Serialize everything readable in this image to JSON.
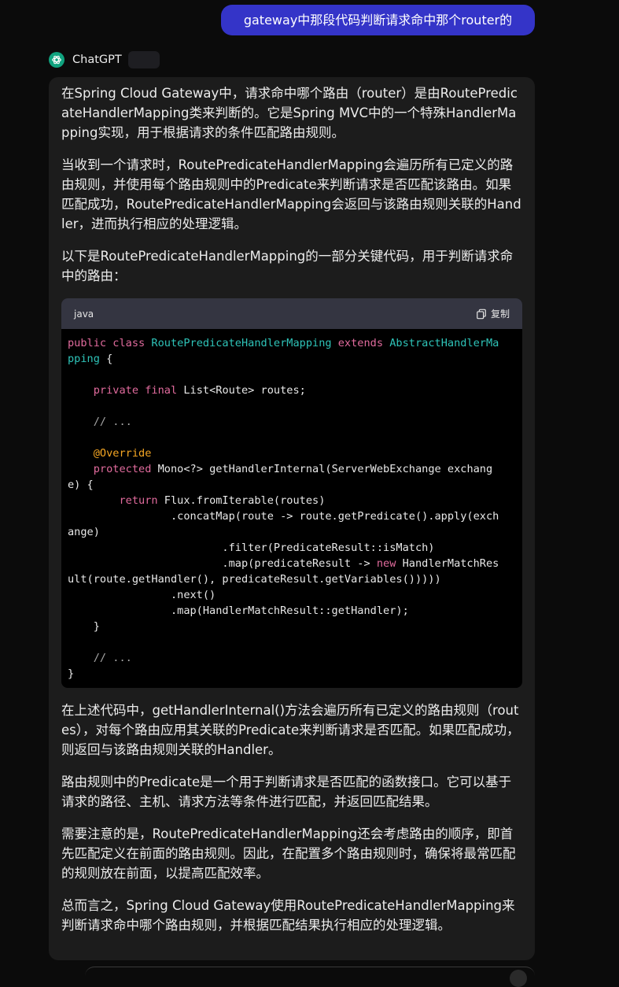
{
  "user_message": "gateway中那段代码判断请求命中那个router的",
  "assistant": {
    "name": "ChatGPT"
  },
  "answer": {
    "p1": "在Spring Cloud Gateway中，请求命中哪个路由（router）是由RoutePredicateHandlerMapping类来判断的。它是Spring MVC中的一个特殊HandlerMapping实现，用于根据请求的条件匹配路由规则。",
    "p2": "当收到一个请求时，RoutePredicateHandlerMapping会遍历所有已定义的路由规则，并使用每个路由规则中的Predicate来判断请求是否匹配该路由。如果匹配成功，RoutePredicateHandlerMapping会返回与该路由规则关联的Handler，进而执行相应的处理逻辑。",
    "p3": "以下是RoutePredicateHandlerMapping的一部分关键代码，用于判断请求命中的路由：",
    "p4": "在上述代码中，getHandlerInternal()方法会遍历所有已定义的路由规则（routes），对每个路由应用其关联的Predicate来判断请求是否匹配。如果匹配成功，则返回与该路由规则关联的Handler。",
    "p5": "路由规则中的Predicate是一个用于判断请求是否匹配的函数接口。它可以基于请求的路径、主机、请求方法等条件进行匹配，并返回匹配结果。",
    "p6": "需要注意的是，RoutePredicateHandlerMapping还会考虑路由的顺序，即首先匹配定义在前面的路由规则。因此，在配置多个路由规则时，确保将最常匹配的规则放在前面，以提高匹配效率。",
    "p7": "总而言之，Spring Cloud Gateway使用RoutePredicateHandlerMapping来判断请求命中哪个路由规则，并根据匹配结果执行相应的处理逻辑。"
  },
  "code": {
    "language": "java",
    "copy_label": "复制",
    "lines": [
      [
        [
          "kw",
          "public class "
        ],
        [
          "cls",
          "RoutePredicateHandlerMapping"
        ],
        [
          "kw",
          " extends "
        ],
        [
          "cls",
          "AbstractHandlerMa"
        ]
      ],
      [
        [
          "cls",
          "pping"
        ],
        [
          "t",
          " {"
        ]
      ],
      [
        [
          "t",
          ""
        ]
      ],
      [
        [
          "t",
          "    "
        ],
        [
          "kw",
          "private final"
        ],
        [
          "t",
          " List<Route> routes;"
        ]
      ],
      [
        [
          "t",
          ""
        ]
      ],
      [
        [
          "t",
          "    "
        ],
        [
          "cm",
          "// ..."
        ]
      ],
      [
        [
          "t",
          ""
        ]
      ],
      [
        [
          "t",
          "    "
        ],
        [
          "ann",
          "@Override"
        ]
      ],
      [
        [
          "t",
          "    "
        ],
        [
          "kw",
          "protected"
        ],
        [
          "t",
          " Mono<?> getHandlerInternal(ServerWebExchange exchang"
        ]
      ],
      [
        [
          "t",
          "e) {"
        ]
      ],
      [
        [
          "t",
          "        "
        ],
        [
          "kw",
          "return"
        ],
        [
          "t",
          " Flux.fromIterable(routes)"
        ]
      ],
      [
        [
          "t",
          "                .concatMap(route -> route.getPredicate().apply(exch"
        ]
      ],
      [
        [
          "t",
          "ange)"
        ]
      ],
      [
        [
          "t",
          "                        .filter(PredicateResult::isMatch)"
        ]
      ],
      [
        [
          "t",
          "                        .map(predicateResult -> "
        ],
        [
          "kw",
          "new"
        ],
        [
          "t",
          " HandlerMatchRes"
        ]
      ],
      [
        [
          "t",
          "ult(route.getHandler(), predicateResult.getVariables()))))"
        ]
      ],
      [
        [
          "t",
          "                .next()"
        ]
      ],
      [
        [
          "t",
          "                .map(HandlerMatchResult::getHandler);"
        ]
      ],
      [
        [
          "t",
          "    }"
        ]
      ],
      [
        [
          "t",
          ""
        ]
      ],
      [
        [
          "t",
          "    "
        ],
        [
          "cm",
          "// ..."
        ]
      ],
      [
        [
          "t",
          "}"
        ]
      ]
    ]
  }
}
